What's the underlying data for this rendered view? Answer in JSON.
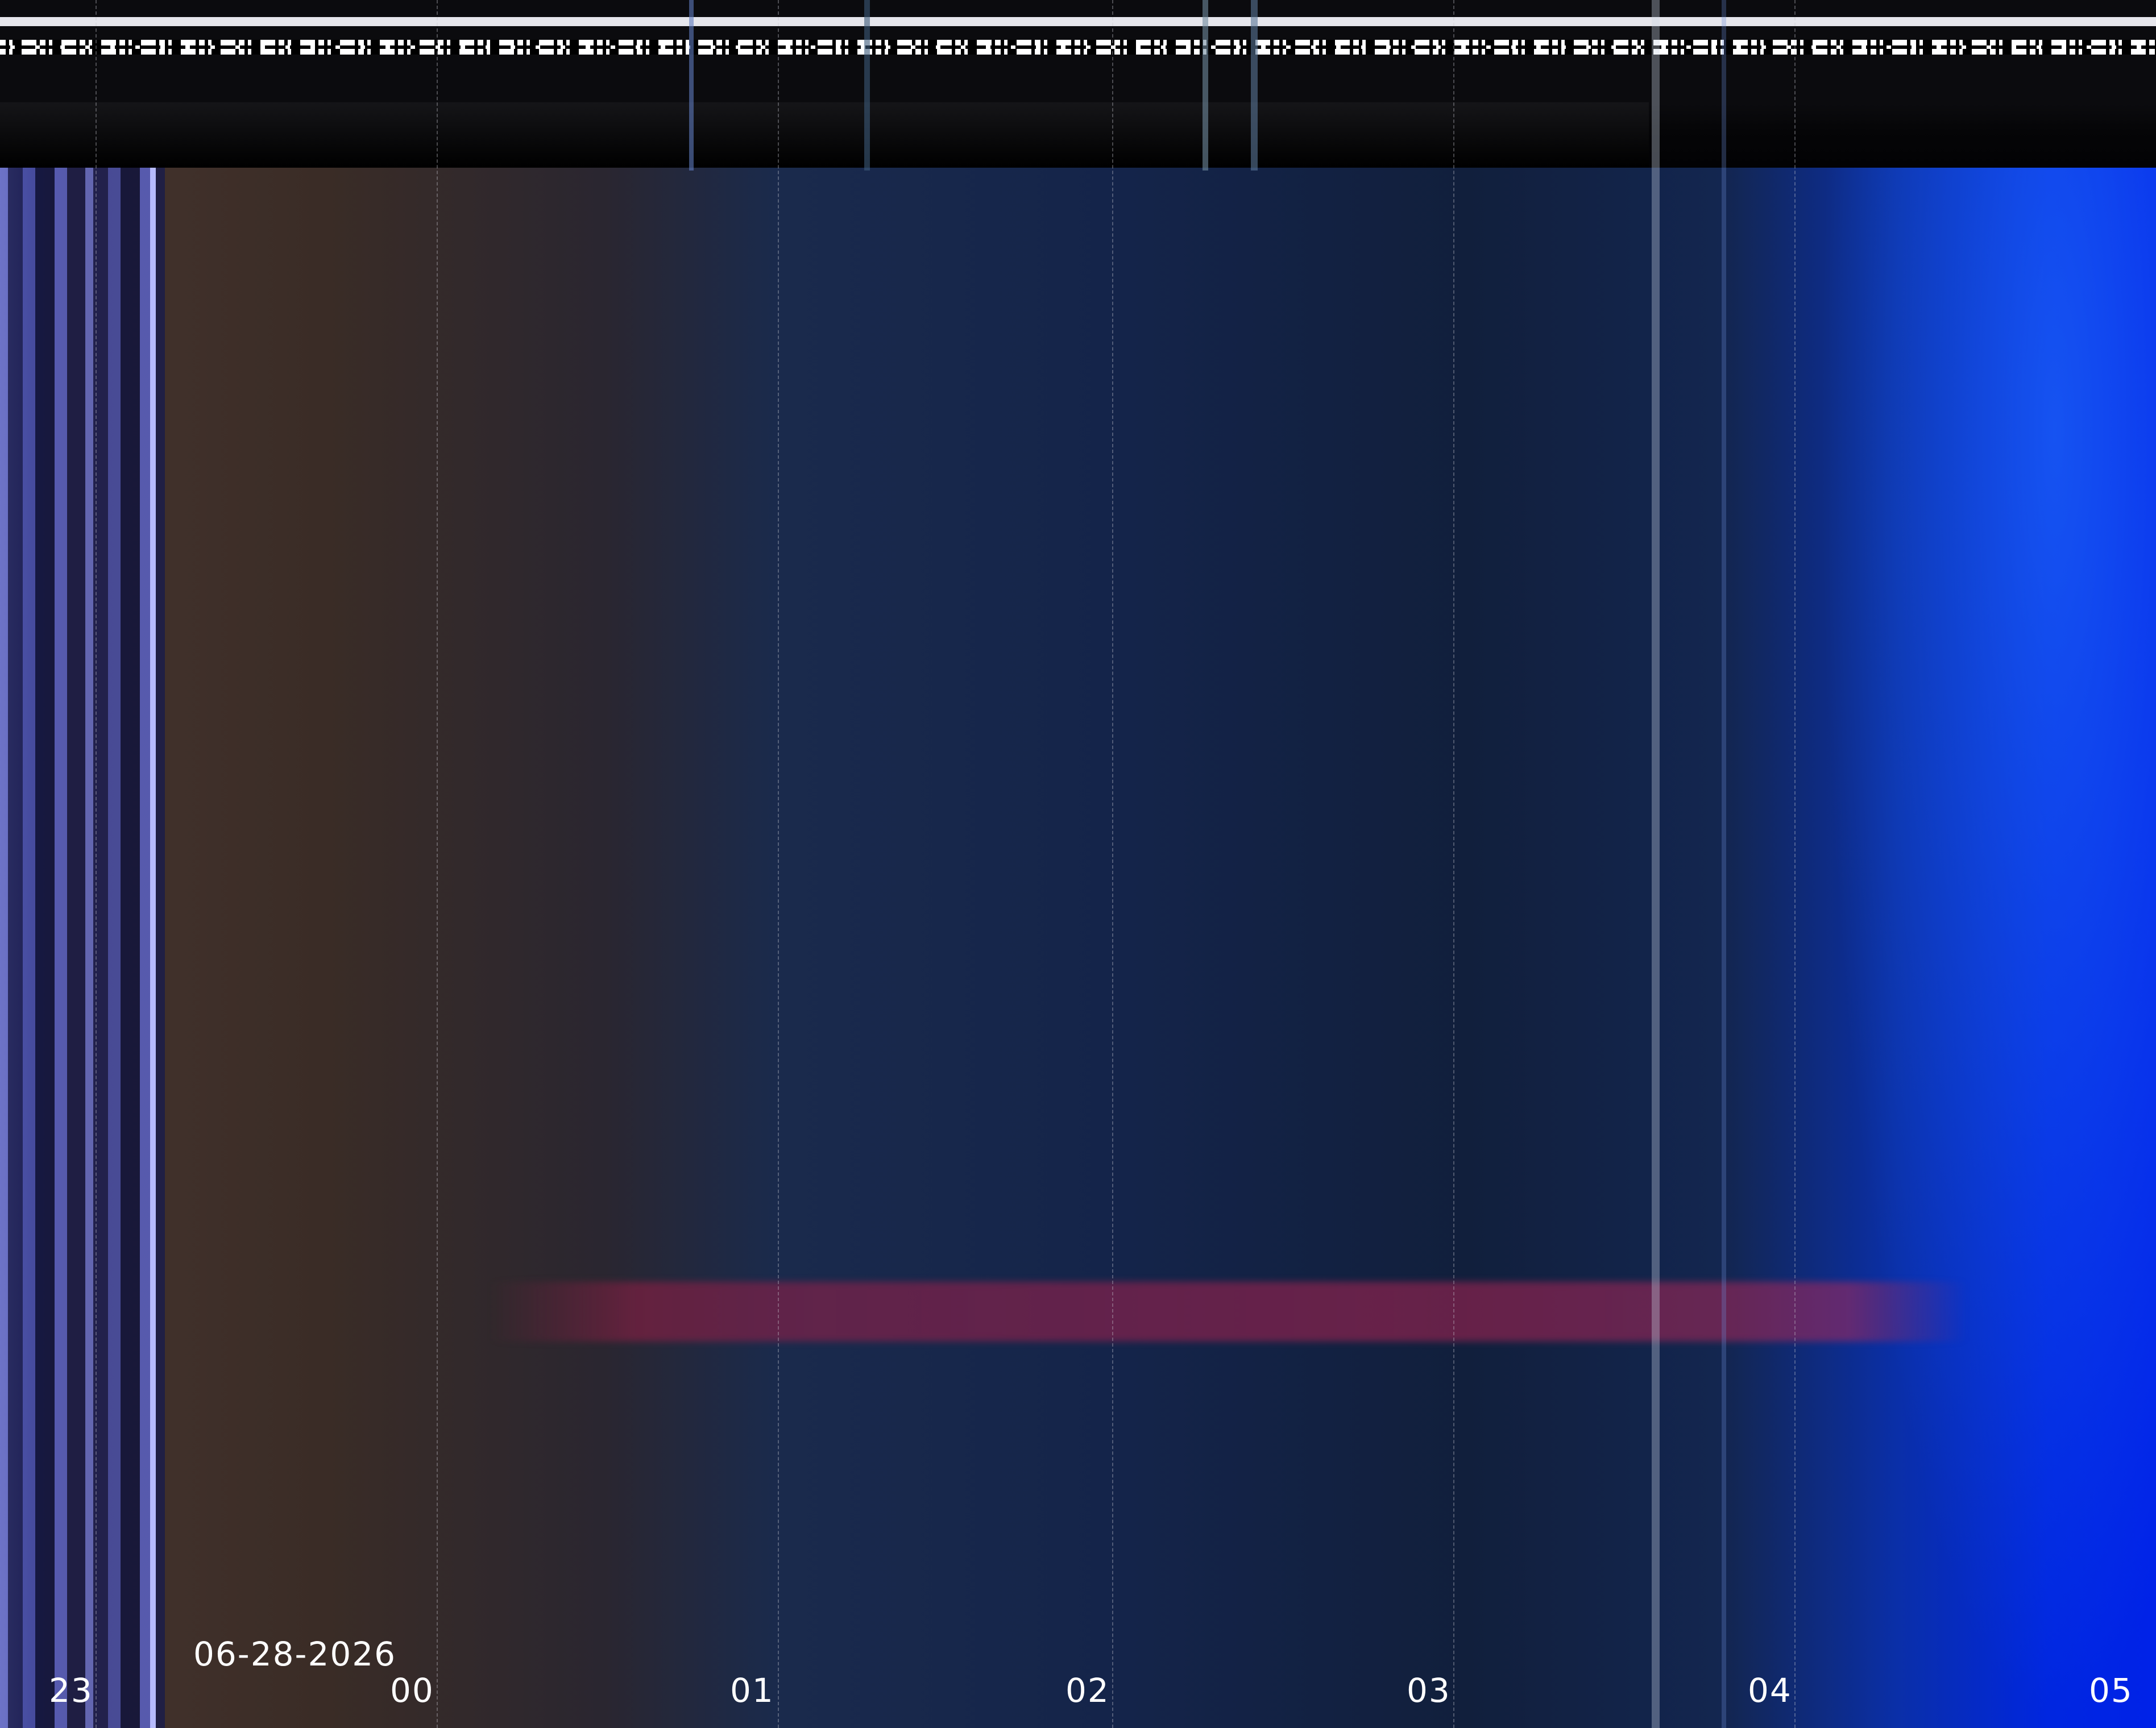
{
  "timeline": {
    "date": "06-28-2026",
    "hour_ticks": [
      "23",
      "00",
      "01",
      "02",
      "03",
      "04",
      "05"
    ]
  },
  "colors": {
    "left_band": "#5b62c4",
    "warm_region": "#40302a",
    "night_blue": "#14244a",
    "dawn_blue": "#0026e0",
    "streak_red": "#a02350",
    "text": "#ffffff"
  }
}
